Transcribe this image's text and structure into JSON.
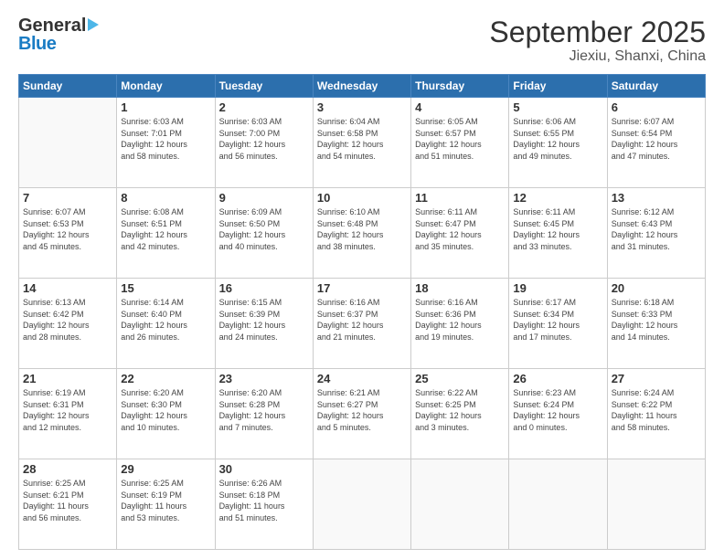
{
  "header": {
    "logo_general": "General",
    "logo_blue": "Blue",
    "title": "September 2025",
    "subtitle": "Jiexiu, Shanxi, China"
  },
  "calendar": {
    "days_of_week": [
      "Sunday",
      "Monday",
      "Tuesday",
      "Wednesday",
      "Thursday",
      "Friday",
      "Saturday"
    ],
    "weeks": [
      [
        {
          "day": "",
          "info": ""
        },
        {
          "day": "1",
          "info": "Sunrise: 6:03 AM\nSunset: 7:01 PM\nDaylight: 12 hours\nand 58 minutes."
        },
        {
          "day": "2",
          "info": "Sunrise: 6:03 AM\nSunset: 7:00 PM\nDaylight: 12 hours\nand 56 minutes."
        },
        {
          "day": "3",
          "info": "Sunrise: 6:04 AM\nSunset: 6:58 PM\nDaylight: 12 hours\nand 54 minutes."
        },
        {
          "day": "4",
          "info": "Sunrise: 6:05 AM\nSunset: 6:57 PM\nDaylight: 12 hours\nand 51 minutes."
        },
        {
          "day": "5",
          "info": "Sunrise: 6:06 AM\nSunset: 6:55 PM\nDaylight: 12 hours\nand 49 minutes."
        },
        {
          "day": "6",
          "info": "Sunrise: 6:07 AM\nSunset: 6:54 PM\nDaylight: 12 hours\nand 47 minutes."
        }
      ],
      [
        {
          "day": "7",
          "info": "Sunrise: 6:07 AM\nSunset: 6:53 PM\nDaylight: 12 hours\nand 45 minutes."
        },
        {
          "day": "8",
          "info": "Sunrise: 6:08 AM\nSunset: 6:51 PM\nDaylight: 12 hours\nand 42 minutes."
        },
        {
          "day": "9",
          "info": "Sunrise: 6:09 AM\nSunset: 6:50 PM\nDaylight: 12 hours\nand 40 minutes."
        },
        {
          "day": "10",
          "info": "Sunrise: 6:10 AM\nSunset: 6:48 PM\nDaylight: 12 hours\nand 38 minutes."
        },
        {
          "day": "11",
          "info": "Sunrise: 6:11 AM\nSunset: 6:47 PM\nDaylight: 12 hours\nand 35 minutes."
        },
        {
          "day": "12",
          "info": "Sunrise: 6:11 AM\nSunset: 6:45 PM\nDaylight: 12 hours\nand 33 minutes."
        },
        {
          "day": "13",
          "info": "Sunrise: 6:12 AM\nSunset: 6:43 PM\nDaylight: 12 hours\nand 31 minutes."
        }
      ],
      [
        {
          "day": "14",
          "info": "Sunrise: 6:13 AM\nSunset: 6:42 PM\nDaylight: 12 hours\nand 28 minutes."
        },
        {
          "day": "15",
          "info": "Sunrise: 6:14 AM\nSunset: 6:40 PM\nDaylight: 12 hours\nand 26 minutes."
        },
        {
          "day": "16",
          "info": "Sunrise: 6:15 AM\nSunset: 6:39 PM\nDaylight: 12 hours\nand 24 minutes."
        },
        {
          "day": "17",
          "info": "Sunrise: 6:16 AM\nSunset: 6:37 PM\nDaylight: 12 hours\nand 21 minutes."
        },
        {
          "day": "18",
          "info": "Sunrise: 6:16 AM\nSunset: 6:36 PM\nDaylight: 12 hours\nand 19 minutes."
        },
        {
          "day": "19",
          "info": "Sunrise: 6:17 AM\nSunset: 6:34 PM\nDaylight: 12 hours\nand 17 minutes."
        },
        {
          "day": "20",
          "info": "Sunrise: 6:18 AM\nSunset: 6:33 PM\nDaylight: 12 hours\nand 14 minutes."
        }
      ],
      [
        {
          "day": "21",
          "info": "Sunrise: 6:19 AM\nSunset: 6:31 PM\nDaylight: 12 hours\nand 12 minutes."
        },
        {
          "day": "22",
          "info": "Sunrise: 6:20 AM\nSunset: 6:30 PM\nDaylight: 12 hours\nand 10 minutes."
        },
        {
          "day": "23",
          "info": "Sunrise: 6:20 AM\nSunset: 6:28 PM\nDaylight: 12 hours\nand 7 minutes."
        },
        {
          "day": "24",
          "info": "Sunrise: 6:21 AM\nSunset: 6:27 PM\nDaylight: 12 hours\nand 5 minutes."
        },
        {
          "day": "25",
          "info": "Sunrise: 6:22 AM\nSunset: 6:25 PM\nDaylight: 12 hours\nand 3 minutes."
        },
        {
          "day": "26",
          "info": "Sunrise: 6:23 AM\nSunset: 6:24 PM\nDaylight: 12 hours\nand 0 minutes."
        },
        {
          "day": "27",
          "info": "Sunrise: 6:24 AM\nSunset: 6:22 PM\nDaylight: 11 hours\nand 58 minutes."
        }
      ],
      [
        {
          "day": "28",
          "info": "Sunrise: 6:25 AM\nSunset: 6:21 PM\nDaylight: 11 hours\nand 56 minutes."
        },
        {
          "day": "29",
          "info": "Sunrise: 6:25 AM\nSunset: 6:19 PM\nDaylight: 11 hours\nand 53 minutes."
        },
        {
          "day": "30",
          "info": "Sunrise: 6:26 AM\nSunset: 6:18 PM\nDaylight: 11 hours\nand 51 minutes."
        },
        {
          "day": "",
          "info": ""
        },
        {
          "day": "",
          "info": ""
        },
        {
          "day": "",
          "info": ""
        },
        {
          "day": "",
          "info": ""
        }
      ]
    ]
  }
}
